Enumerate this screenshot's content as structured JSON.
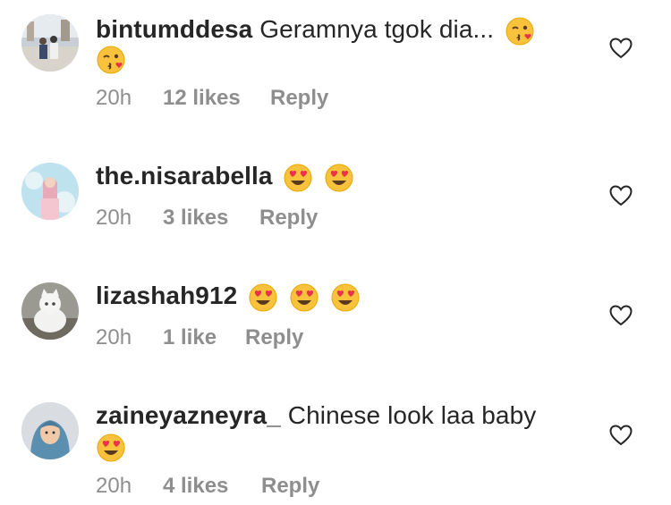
{
  "comments": [
    {
      "username": "bintumddesa",
      "text": "Geramnya tgok dia...",
      "emojis_inline": [
        "kissing-wink-emoji"
      ],
      "emojis_second_line": [
        "kissing-wink-emoji"
      ],
      "time": "20h",
      "likes": "12 likes",
      "reply": "Reply",
      "avatar": "avatar-bintumddesa"
    },
    {
      "username": "the.nisarabella",
      "text": "",
      "emojis_inline": [
        "heart-eyes-emoji",
        "heart-eyes-emoji"
      ],
      "emojis_second_line": [],
      "time": "20h",
      "likes": "3 likes",
      "reply": "Reply",
      "avatar": "avatar-the-nisarabella"
    },
    {
      "username": "lizashah912",
      "text": "",
      "emojis_inline": [
        "heart-eyes-emoji",
        "heart-eyes-emoji",
        "heart-eyes-emoji"
      ],
      "emojis_second_line": [],
      "time": "20h",
      "likes": "1 like",
      "reply": "Reply",
      "avatar": "avatar-lizashah912"
    },
    {
      "username": "zaineyazneyra_",
      "text": "Chinese look laa baby",
      "emojis_inline": [],
      "emojis_second_line": [
        "heart-eyes-emoji"
      ],
      "time": "20h",
      "likes": "4 likes",
      "reply": "Reply",
      "avatar": "avatar-zaineyazneyra"
    }
  ],
  "icons": {
    "like": "heart-outline-icon"
  },
  "colors": {
    "text": "#262626",
    "meta": "#8e8e8e"
  }
}
